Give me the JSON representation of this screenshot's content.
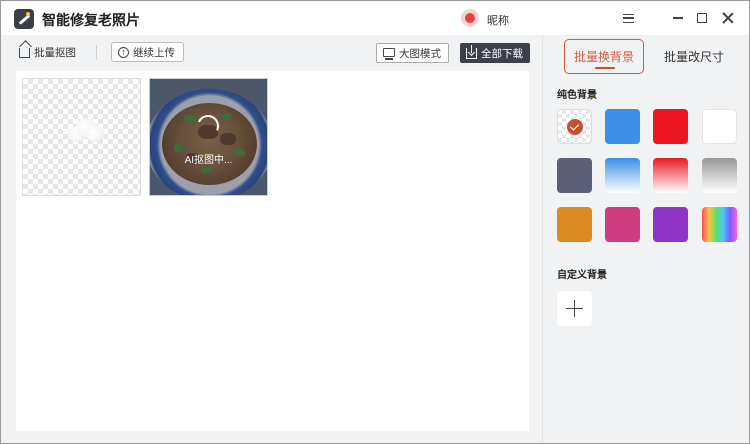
{
  "app": {
    "title": "智能修复老照片"
  },
  "user": {
    "nickname": "昵称"
  },
  "toolbar": {
    "batch_cutout_label": "批量抠图",
    "continue_upload_label": "继续上传",
    "big_mode_label": "大图模式",
    "download_all_label": "全部下载"
  },
  "images": [
    {
      "status_text": ""
    },
    {
      "status_text": "AI抠图中..."
    }
  ],
  "panel": {
    "tabs": [
      {
        "label": "批量换背景",
        "active": true
      },
      {
        "label": "批量改尺寸",
        "active": false
      }
    ],
    "solid_title": "纯色背景",
    "custom_title": "自定义背景",
    "colors": [
      {
        "name": "transparent",
        "value": "transparent",
        "selected": true
      },
      {
        "name": "blue",
        "value": "#3b8fe6"
      },
      {
        "name": "red",
        "value": "#ea1520"
      },
      {
        "name": "white",
        "value": "#ffffff"
      },
      {
        "name": "slate",
        "value": "#5d5f78"
      },
      {
        "name": "blue-gradient",
        "value": "linear-gradient(#3b8fe6,#ffffff)"
      },
      {
        "name": "red-gradient",
        "value": "linear-gradient(#e81a24,#ffffff)"
      },
      {
        "name": "gray-gradient",
        "value": "linear-gradient(#999999,#ffffff)"
      },
      {
        "name": "orange",
        "value": "#d98b22"
      },
      {
        "name": "pink",
        "value": "#cc3c7e"
      },
      {
        "name": "purple",
        "value": "#8f33c9"
      },
      {
        "name": "rainbow",
        "value": "linear-gradient(90deg,#ff4b4b,#ffc14b,#5de35d,#4bc6ff,#7b5cff,#ff5ce1)"
      }
    ]
  },
  "colors": {
    "accent": "#d9593d",
    "download_btn": "#3d404b"
  }
}
